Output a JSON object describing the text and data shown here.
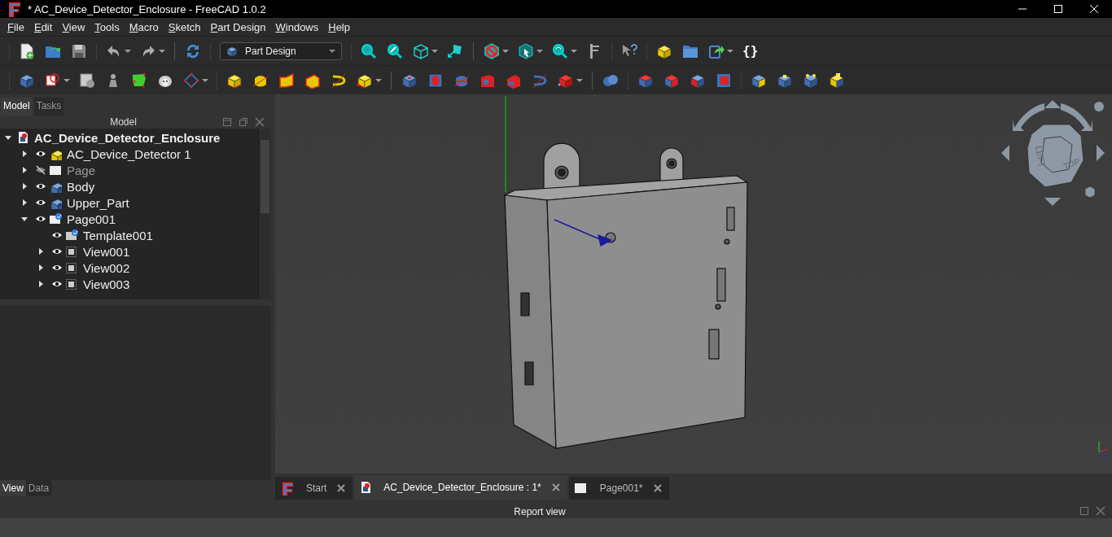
{
  "window": {
    "title": "* AC_Device_Detector_Enclosure - FreeCAD 1.0.2"
  },
  "menu": [
    "File",
    "Edit",
    "View",
    "Tools",
    "Macro",
    "Sketch",
    "Part Design",
    "Windows",
    "Help"
  ],
  "toolbar": {
    "workbench": "Part Design",
    "python_console": "{}"
  },
  "combo_view": {
    "tabs": [
      {
        "label": "Model",
        "selected": true
      },
      {
        "label": "Tasks",
        "selected": false
      }
    ],
    "title": "Model",
    "tree": {
      "label": "AC_Device_Detector_Enclosure",
      "kind": "document",
      "expanded": true,
      "children": [
        {
          "label": "AC_Device_Detector 1",
          "kind": "part",
          "visible": true,
          "expanded": false
        },
        {
          "label": "Page",
          "kind": "page",
          "visible": false,
          "expanded": false
        },
        {
          "label": "Body",
          "kind": "body",
          "visible": true,
          "expanded": false
        },
        {
          "label": "Upper_Part",
          "kind": "body",
          "visible": true,
          "expanded": false
        },
        {
          "label": "Page001",
          "kind": "drawing",
          "visible": true,
          "expanded": true,
          "children": [
            {
              "label": "Template001",
              "kind": "template",
              "visible": true
            },
            {
              "label": "View001",
              "kind": "view",
              "visible": true,
              "expanded": false
            },
            {
              "label": "View002",
              "kind": "view",
              "visible": true,
              "expanded": false
            },
            {
              "label": "View003",
              "kind": "view",
              "visible": true,
              "expanded": false
            }
          ]
        }
      ]
    }
  },
  "property_view": {
    "tabs": [
      {
        "label": "View",
        "selected": true
      },
      {
        "label": "Data",
        "selected": false
      }
    ]
  },
  "viewport": {
    "nav_cube": {
      "faces": [
        "LEFT",
        "TOP"
      ]
    }
  },
  "document_tabs": [
    {
      "label": "Start",
      "kind": "start",
      "selected": false
    },
    {
      "label": "AC_Device_Detector_Enclosure : 1*",
      "kind": "document",
      "selected": true
    },
    {
      "label": "Page001*",
      "kind": "page",
      "selected": false
    }
  ],
  "report_view": {
    "title": "Report view"
  }
}
